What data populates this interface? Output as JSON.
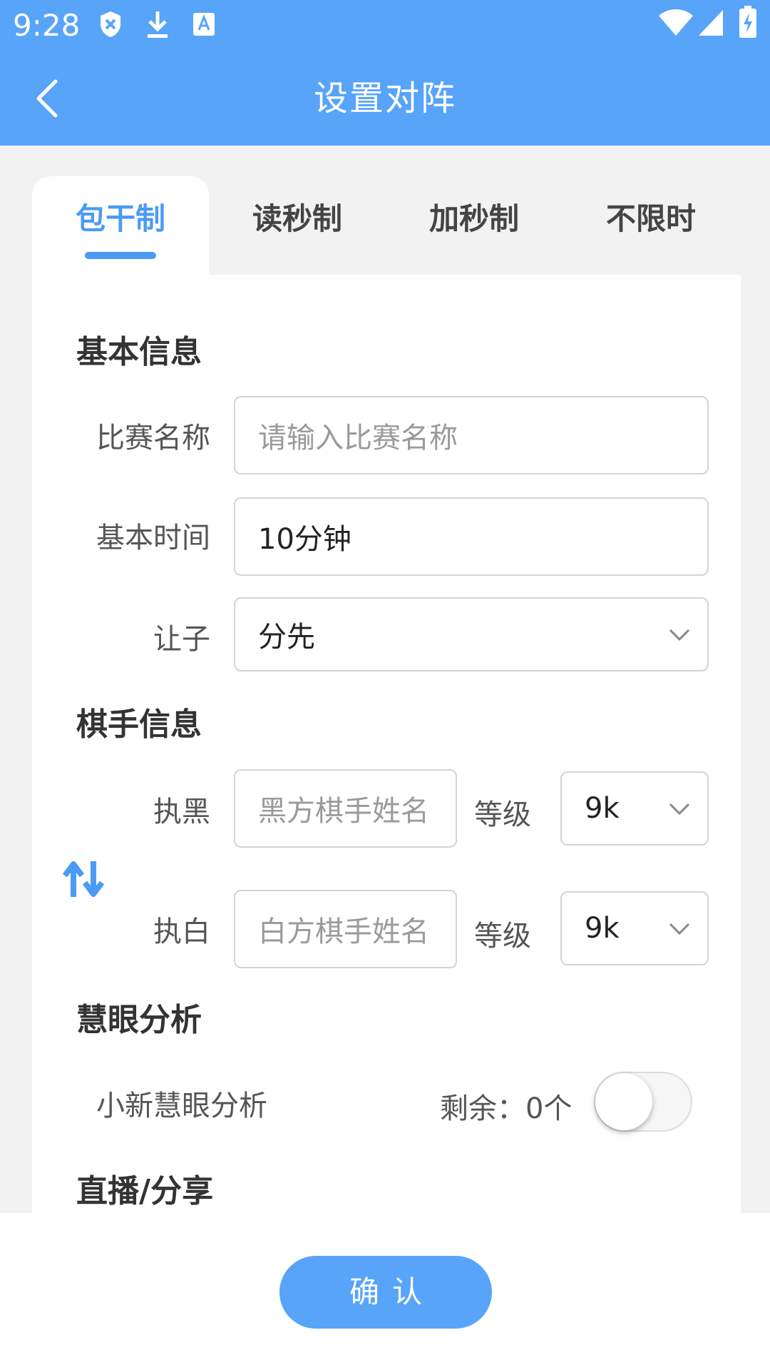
{
  "status_bar": {
    "time": "9:28",
    "icons": [
      "shield-x-icon",
      "download-icon",
      "translate-a-icon",
      "wifi-icon",
      "signal-icon",
      "battery-charging-icon"
    ]
  },
  "header": {
    "title": "设置对阵",
    "back_icon": "chevron-left-icon"
  },
  "tabs": [
    {
      "label": "包干制",
      "active": true
    },
    {
      "label": "读秒制",
      "active": false
    },
    {
      "label": "加秒制",
      "active": false
    },
    {
      "label": "不限时",
      "active": false
    }
  ],
  "basic_info": {
    "heading": "基本信息",
    "match_name": {
      "label": "比赛名称",
      "placeholder": "请输入比赛名称",
      "value": ""
    },
    "base_time": {
      "label": "基本时间",
      "value": "10分钟"
    },
    "handicap": {
      "label": "让子",
      "value": "分先"
    }
  },
  "player_info": {
    "heading": "棋手信息",
    "black": {
      "label": "执黑",
      "placeholder": "黑方棋手姓名",
      "grade_label": "等级",
      "grade": "9k"
    },
    "white": {
      "label": "执白",
      "placeholder": "白方棋手姓名",
      "grade_label": "等级",
      "grade": "9k"
    },
    "swap_icon": "swap-arrows-icon"
  },
  "analysis": {
    "heading": "慧眼分析",
    "option_label": "小新慧眼分析",
    "remaining": "剩余：0个",
    "enabled": false
  },
  "live": {
    "heading": "直播/分享"
  },
  "footer": {
    "confirm_label": "确认"
  },
  "colors": {
    "accent": "#57a4f9",
    "tab_active": "#4b9af5",
    "background": "#f2f2f2"
  }
}
